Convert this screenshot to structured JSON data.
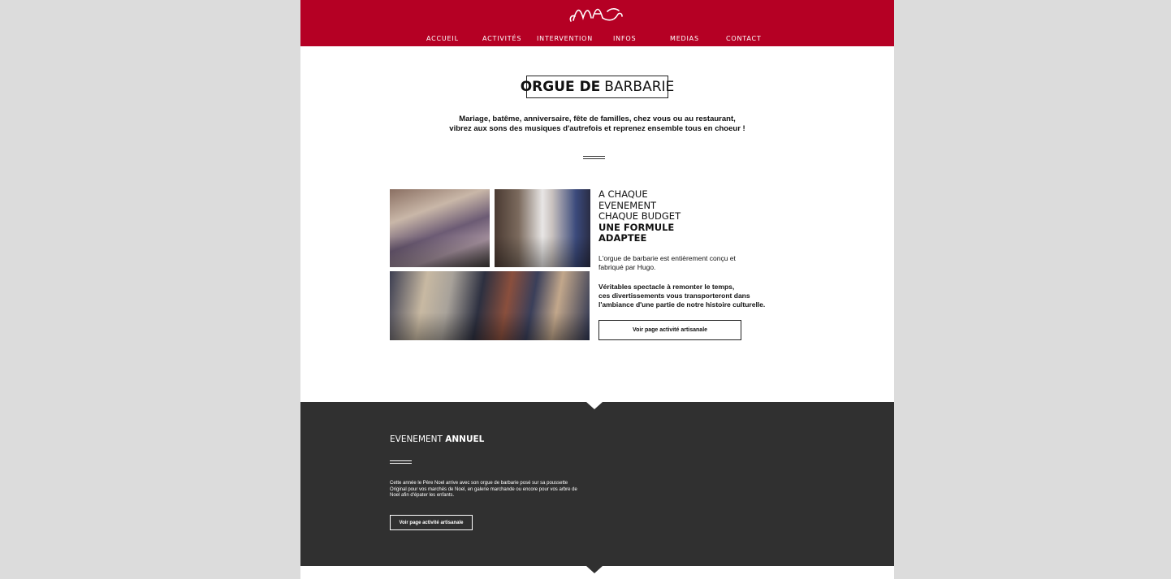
{
  "brand": {
    "accent": "#b50024",
    "dark": "#303030",
    "logo_text": "MA"
  },
  "nav": {
    "items": [
      "ACCUEIL",
      "ACTIVITÉS",
      "INTERVENTION",
      "INFOS",
      "MEDIAS",
      "CONTACT"
    ]
  },
  "hero": {
    "title_bold": "ORGUE DE",
    "title_light": "BARBARIE",
    "intro_line1": "Mariage, batême, anniversaire, fête de familles, chez vous ou au restaurant,",
    "intro_line2": "vibrez aux sons des musiques d'autrefois et reprenez ensemble tous en choeur !"
  },
  "feature": {
    "headline_light": [
      "A CHAQUE",
      "EVENEMENT",
      "CHAQUE BUDGET"
    ],
    "headline_bold": [
      "UNE FORMULE",
      "ADAPTEE"
    ],
    "description": "L'orgue de barbarie est entièrement conçu et fabriqué par Hugo.",
    "strong_lines": [
      "Véritables spectacle à remonter le temps,",
      "ces divertissements vous transporteront dans",
      "l'ambiance d'une partie de notre histoire culturelle."
    ],
    "button_label": "Voir page activité artisanale"
  },
  "annual": {
    "title_light": "EVENEMENT",
    "title_bold": "ANNUEL",
    "text_lines": [
      "Cette année le Père Noel arrive avec son orgue de barbarie posé sur sa poussette",
      "Original pour vos marchés de Noel, en galerie marchande ou encore pour vos arbre de",
      "Noel afin d'épater les enfants."
    ],
    "button_label": "Voir page activité artisanale"
  }
}
